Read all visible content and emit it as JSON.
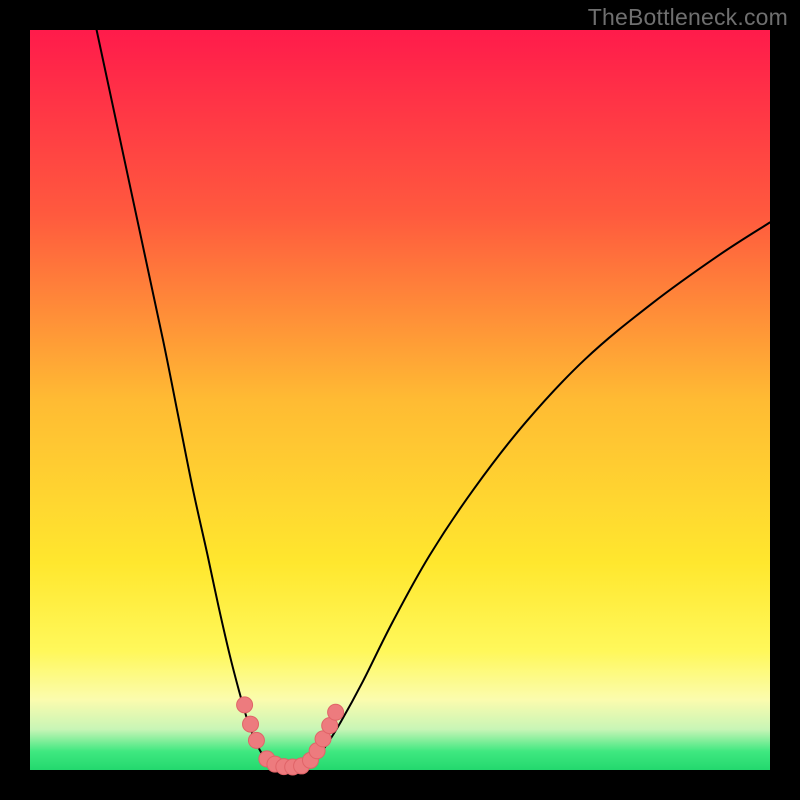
{
  "watermark": "TheBottleneck.com",
  "colors": {
    "frame": "#000000",
    "curve": "#000000",
    "marker_fill": "#ed7b7e",
    "marker_stroke": "#e06468",
    "green_band": "#27e276",
    "gradient_stops": [
      {
        "offset": 0.0,
        "color": "#ff1b4b"
      },
      {
        "offset": 0.25,
        "color": "#ff5a3e"
      },
      {
        "offset": 0.5,
        "color": "#ffbb33"
      },
      {
        "offset": 0.72,
        "color": "#ffe72e"
      },
      {
        "offset": 0.84,
        "color": "#fff85b"
      },
      {
        "offset": 0.905,
        "color": "#fbfcae"
      },
      {
        "offset": 0.945,
        "color": "#c8f5b6"
      },
      {
        "offset": 0.975,
        "color": "#3fe880"
      },
      {
        "offset": 1.0,
        "color": "#23d86e"
      }
    ]
  },
  "chart_data": {
    "type": "line",
    "title": "",
    "xlabel": "",
    "ylabel": "",
    "xlim": [
      0,
      100
    ],
    "ylim": [
      0,
      100
    ],
    "series": [
      {
        "name": "left-branch",
        "x": [
          9,
          12,
          15,
          18,
          20,
          22,
          24,
          25.5,
          27,
          28.3,
          29.3,
          30.2,
          31.0,
          31.6,
          32.2,
          33.0
        ],
        "y": [
          100,
          86,
          72,
          58,
          48,
          38,
          29,
          22,
          15.5,
          10.5,
          7.0,
          4.5,
          2.8,
          1.8,
          1.0,
          0.5
        ]
      },
      {
        "name": "right-branch",
        "x": [
          37.5,
          38.5,
          40,
          42,
          45,
          49,
          54,
          60,
          67,
          75,
          84,
          93,
          100
        ],
        "y": [
          0.5,
          1.5,
          3.3,
          6.5,
          12,
          20,
          29,
          38,
          47,
          55.5,
          63,
          69.5,
          74
        ]
      },
      {
        "name": "valley-floor",
        "x": [
          33.0,
          34.0,
          35.0,
          36.0,
          37.0,
          37.5
        ],
        "y": [
          0.5,
          0.15,
          0.05,
          0.05,
          0.15,
          0.5
        ]
      }
    ],
    "markers": {
      "name": "highlight-dots",
      "points": [
        {
          "x": 29.0,
          "y": 8.8
        },
        {
          "x": 29.8,
          "y": 6.2
        },
        {
          "x": 30.6,
          "y": 4.0
        },
        {
          "x": 32.0,
          "y": 1.5
        },
        {
          "x": 33.1,
          "y": 0.8
        },
        {
          "x": 34.3,
          "y": 0.45
        },
        {
          "x": 35.5,
          "y": 0.4
        },
        {
          "x": 36.7,
          "y": 0.55
        },
        {
          "x": 37.9,
          "y": 1.3
        },
        {
          "x": 38.8,
          "y": 2.6
        },
        {
          "x": 39.6,
          "y": 4.2
        },
        {
          "x": 40.5,
          "y": 6.0
        },
        {
          "x": 41.3,
          "y": 7.8
        }
      ],
      "radius": 8
    }
  }
}
